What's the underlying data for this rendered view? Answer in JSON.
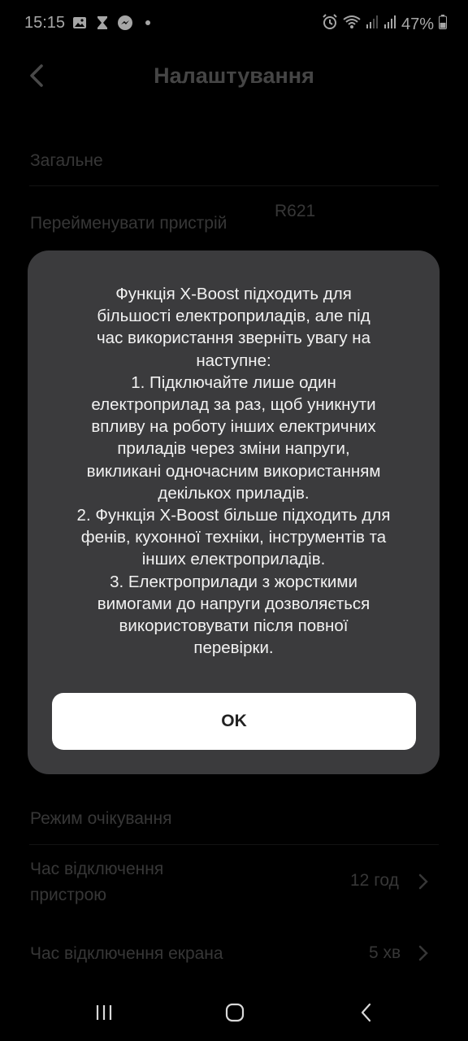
{
  "status_bar": {
    "time": "15:15",
    "battery": "47%",
    "left_icons": [
      "gallery-icon",
      "hourglass-icon",
      "messenger-icon",
      "dot-icon"
    ],
    "right_icons": [
      "alarm-icon",
      "wifi-icon",
      "signal-icon",
      "signal-icon",
      "battery-icon"
    ]
  },
  "header": {
    "title": "Налаштування"
  },
  "settings": {
    "section_general": "Загальне",
    "rename_label": "Перейменувати пристрій",
    "rename_value": "R621",
    "section_standby": "Режим очікування",
    "device_off_label_line1": "Час відключення",
    "device_off_label_line2": "пристрою",
    "device_off_value": "12 год",
    "screen_off_label": "Час відключення екрана",
    "screen_off_value": "5 хв"
  },
  "dialog": {
    "message_lines": [
      "Функція X-Boost підходить для",
      "більшості електроприладів, але під",
      "час використання зверніть увагу на",
      "наступне:",
      "1. Підключайте лише один",
      "електроприлад за раз, щоб уникнути",
      "впливу на роботу інших електричних",
      "приладів через зміни напруги,",
      "викликані одночасним використанням",
      "декількох приладів.",
      "2. Функція X-Boost більше підходить для",
      "фенів, кухонної техніки, інструментів та",
      "інших електроприладів.",
      "3. Електроприлади з жорсткими",
      "вимогами до напруги дозволяється",
      "використовувати після повної",
      "перевірки."
    ],
    "ok_label": "OK"
  },
  "colors": {
    "background": "#000000",
    "dialog_bg": "#3b3b3d",
    "button_bg": "#ffffff",
    "dimmed_text": "#555555"
  }
}
